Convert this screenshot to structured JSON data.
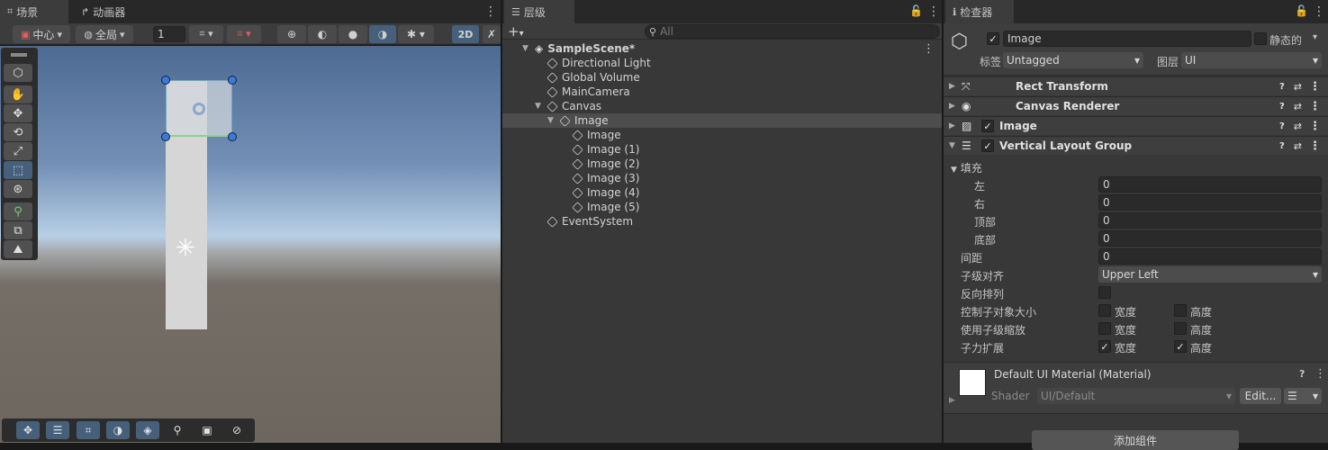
{
  "scene": {
    "tabs": [
      {
        "label": "场景"
      },
      {
        "label": "动画器"
      }
    ],
    "toolbar": {
      "pivot": "中心",
      "space": "全局",
      "snap_value": "1",
      "mode_2d": "2D"
    },
    "view_tools": [
      "hand-tool",
      "move-tool",
      "rotate-tool",
      "scale-tool",
      "rect-tool",
      "transform-tool",
      "custom-tool",
      "snap-tool",
      "terrain-tool"
    ]
  },
  "hierarchy": {
    "tab_label": "层级",
    "search_placeholder": "All",
    "items": [
      {
        "label": "SampleScene*",
        "depth": 0,
        "arrow": "down",
        "icon": "unity-icon"
      },
      {
        "label": "Directional Light",
        "depth": 1
      },
      {
        "label": "Global Volume",
        "depth": 1
      },
      {
        "label": "MainCamera",
        "depth": 1
      },
      {
        "label": "Canvas",
        "depth": 1,
        "arrow": "down"
      },
      {
        "label": "Image",
        "depth": 2,
        "arrow": "down",
        "selected": true
      },
      {
        "label": "Image",
        "depth": 3
      },
      {
        "label": "Image (1)",
        "depth": 3
      },
      {
        "label": "Image (2)",
        "depth": 3
      },
      {
        "label": "Image (3)",
        "depth": 3
      },
      {
        "label": "Image (4)",
        "depth": 3
      },
      {
        "label": "Image (5)",
        "depth": 3
      },
      {
        "label": "EventSystem",
        "depth": 1
      }
    ]
  },
  "inspector": {
    "tab_label": "检查器",
    "object_name": "Image",
    "static_label": "静态的",
    "tag_label": "标签",
    "tag_value": "Untagged",
    "layer_label": "图层",
    "layer_value": "UI",
    "components": [
      {
        "name": "Rect Transform",
        "icon": "rect-transform-icon",
        "has_check": false
      },
      {
        "name": "Canvas Renderer",
        "icon": "eye-icon",
        "has_check": false
      },
      {
        "name": "Image",
        "icon": "image-icon",
        "has_check": true
      },
      {
        "name": "Vertical Layout Group",
        "icon": "layout-icon",
        "has_check": true
      }
    ],
    "layout": {
      "padding_label": "填充",
      "left_label": "左",
      "left_value": "0",
      "right_label": "右",
      "right_value": "0",
      "top_label": "顶部",
      "top_value": "0",
      "bottom_label": "底部",
      "bottom_value": "0",
      "spacing_label": "间距",
      "spacing_value": "0",
      "child_align_label": "子级对齐",
      "child_align_value": "Upper Left",
      "reverse_label": "反向排列",
      "control_size_label": "控制子对象大小",
      "use_scale_label": "使用子级缩放",
      "force_expand_label": "子力扩展",
      "width_label": "宽度",
      "height_label": "高度"
    },
    "material": {
      "name": "Default UI Material (Material)",
      "shader_label": "Shader",
      "shader_value": "UI/Default",
      "edit_label": "Edit..."
    },
    "add_component_label": "添加组件"
  }
}
